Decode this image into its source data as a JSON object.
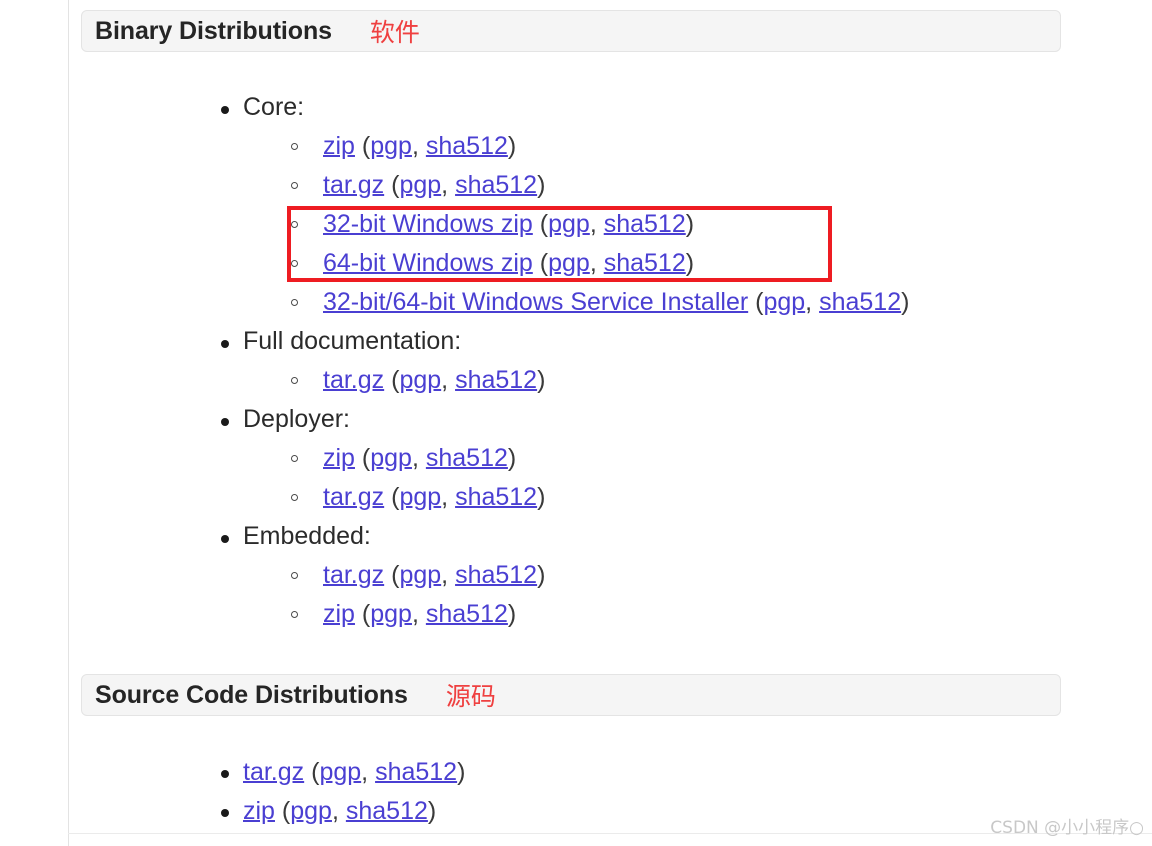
{
  "page": {
    "sections": [
      {
        "id": "binary",
        "title": "Binary Distributions",
        "cn_note": "软件",
        "groups": [
          {
            "label": "Core:",
            "items": [
              {
                "name": "zip",
                "sig": "pgp",
                "hash": "sha512"
              },
              {
                "name": "tar.gz",
                "sig": "pgp",
                "hash": "sha512"
              },
              {
                "name": "32-bit Windows zip",
                "sig": "pgp",
                "hash": "sha512"
              },
              {
                "name": "64-bit Windows zip",
                "sig": "pgp",
                "hash": "sha512"
              },
              {
                "name": "32-bit/64-bit Windows Service Installer",
                "sig": "pgp",
                "hash": "sha512"
              }
            ]
          },
          {
            "label": "Full documentation:",
            "items": [
              {
                "name": "tar.gz",
                "sig": "pgp",
                "hash": "sha512"
              }
            ]
          },
          {
            "label": "Deployer:",
            "items": [
              {
                "name": "zip",
                "sig": "pgp",
                "hash": "sha512"
              },
              {
                "name": "tar.gz",
                "sig": "pgp",
                "hash": "sha512"
              }
            ]
          },
          {
            "label": "Embedded:",
            "items": [
              {
                "name": "tar.gz",
                "sig": "pgp",
                "hash": "sha512"
              },
              {
                "name": "zip",
                "sig": "pgp",
                "hash": "sha512"
              }
            ]
          }
        ]
      },
      {
        "id": "source",
        "title": "Source Code Distributions",
        "cn_note": "源码",
        "flat_items": [
          {
            "name": "tar.gz",
            "sig": "pgp",
            "hash": "sha512"
          },
          {
            "name": "zip",
            "sig": "pgp",
            "hash": "sha512"
          }
        ]
      }
    ],
    "annotation": {
      "shape": "rectangle",
      "color": "#ee1c22",
      "highlights": [
        "32-bit Windows zip",
        "64-bit Windows zip"
      ]
    },
    "watermark": "CSDN @小小程序○",
    "colors": {
      "link": "#4a3fd2",
      "text": "#2b2b2b",
      "header_bg": "#f5f5f5",
      "annotation_red": "#ee1c22",
      "cn_note_red": "#ef4040"
    },
    "punct": {
      "open": " (",
      "sep": ", ",
      "close": ")"
    }
  }
}
